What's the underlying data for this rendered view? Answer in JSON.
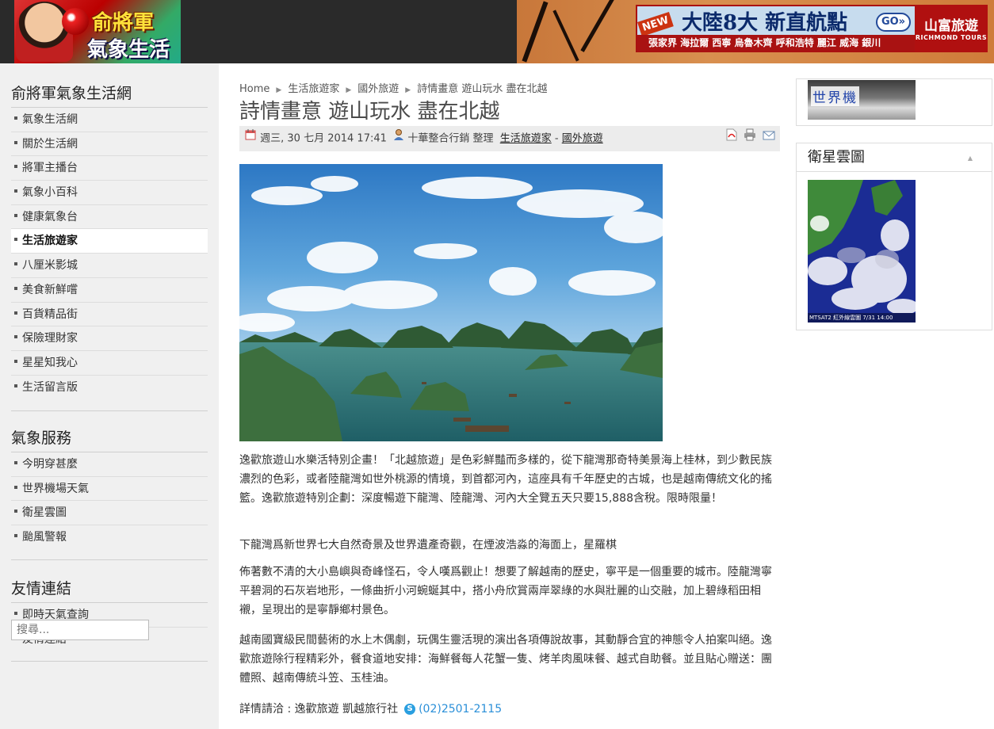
{
  "header": {
    "logo_line1": "俞將軍",
    "logo_line2": "氣象生活網",
    "ad_new": "NEW",
    "ad_headline": "大陸8大 新直航點",
    "ad_go": "GO»",
    "ad_cities": "張家界 海拉爾 西寧 烏魯木齊 呼和浩特 麗江 威海 銀川",
    "ad_brand": "山富旅遊",
    "ad_brand_en": "RICHMOND TOURS"
  },
  "sidebar": {
    "sections": [
      {
        "title": "俞將軍氣象生活網",
        "items": [
          "氣象生活網",
          "關於生活網",
          "將軍主播台",
          "氣象小百科",
          "健康氣象台",
          "生活旅遊家",
          "八厘米影城",
          "美食新鮮嚐",
          "百貨精品街",
          "保險理財家",
          "星星知我心",
          "生活留言版"
        ],
        "active": "生活旅遊家"
      },
      {
        "title": "氣象服務",
        "items": [
          "今明穿甚麼",
          "世界機場天氣",
          "衛星雲圖",
          "颱風警報"
        ]
      },
      {
        "title": "友情連結",
        "items": [
          "即時天氣查詢",
          "友情連結"
        ]
      }
    ],
    "search_placeholder": "搜尋..."
  },
  "breadcrumb": [
    "Home",
    "生活旅遊家",
    "國外旅遊",
    "詩情畫意 遊山玩水 盡在北越"
  ],
  "article": {
    "title": "詩情畫意 遊山玩水 盡在北越",
    "date": "週三, 30 七月 2014 17:41",
    "author": "十華整合行銷 整理",
    "category_1": "生活旅遊家",
    "category_sep": "-",
    "category_2": "國外旅遊",
    "paragraphs": [
      "逸歡旅遊山水樂活特別企畫！「北越旅遊」是色彩鮮豔而多樣的，從下龍灣那奇特美景海上桂林，到少數民族濃烈的色彩，或者陸龍灣如世外桃源的情境，到首都河內，這座具有千年歷史的古城，也是越南傳統文化的搖籃。逸歡旅遊特別企劃：深度暢遊下龍灣、陸龍灣、河內大全覽五天只要15,888含稅。限時限量！",
      "下龍灣爲新世界七大自然奇景及世界遺產奇觀，在煙波浩淼的海面上，星羅棋",
      "佈著數不清的大小島嶼與奇峰怪石，令人嘆爲觀止！想要了解越南的歷史，寧平是一個重要的城市。陸龍灣寧平碧洞的石灰岩地形，一條曲折小河蜿蜒其中，搭小舟欣賞兩岸翠綠的水與壯麗的山交融，加上碧綠稻田相襯，呈現出的是寧靜鄉村景色。",
      "越南國寶級民間藝術的水上木偶劇，玩偶生靈活現的演出各項傳說故事，其動靜合宜的神態令人拍案叫絕。逸歡旅遊除行程精彩外，餐食道地安排：海鮮餐每人花蟹一隻、烤羊肉風味餐、越式自助餐。並且貼心贈送：團體照、越南傳統斗笠、玉桂油。"
    ],
    "contact_label": "詳情請洽 : 逸歡旅遊 凱越旅行社",
    "contact_phone": "(02)2501-2115"
  },
  "right": {
    "world_logo": "世界機",
    "sat_title": "衛星雲圖",
    "sat_caption": "MTSAT2 紅外線雲圖 7/31 14:00"
  },
  "colors": {
    "header_bg": "#2a2a2a",
    "sidebar_bg": "#f0f0f0",
    "meta_bar_bg": "#ececec",
    "link_blue": "#2a8fd8"
  }
}
